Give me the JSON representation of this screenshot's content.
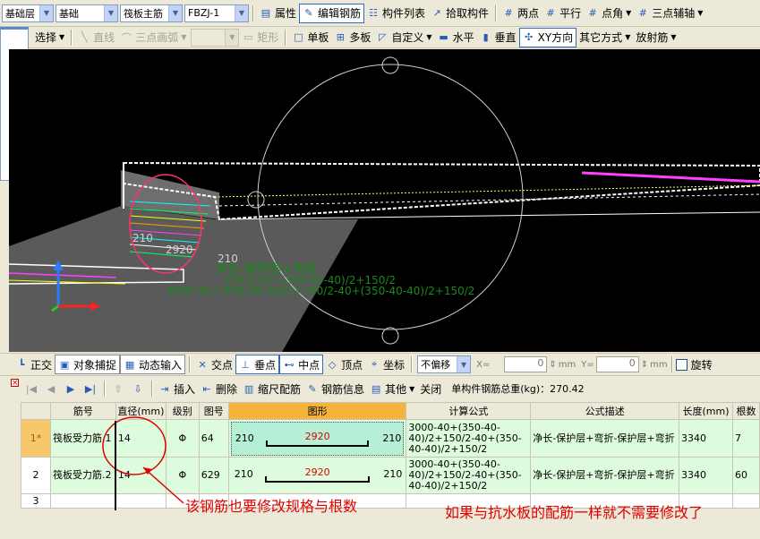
{
  "toolbar1": {
    "layer_select": "基础层",
    "category_select": "基础",
    "member_type_select": "筏板主筋",
    "member_name_select": "FBZJ-1",
    "buttons": [
      "属性",
      "编辑钢筋",
      "构件列表",
      "拾取构件",
      "两点",
      "平行",
      "点角",
      "三点辅轴"
    ]
  },
  "toolbar2": {
    "items": [
      "选择",
      "直线",
      "三点画弧",
      "矩形",
      "单板",
      "多板",
      "自定义",
      "水平",
      "垂直",
      "XY方向",
      "其它方式",
      "放射筋"
    ]
  },
  "viewport": {
    "labels": {
      "dim_210": "210",
      "dim_2920": "2920",
      "dim_210_b": "210",
      "green_text_1": "净长-保护层+弯折",
      "green_text_2": "150/2-40+(350-40-40)/2+150/2",
      "green_text_3": "3000-40+(350-40-40)/2+150/2-40+(350-40-40)/2+150/2"
    }
  },
  "toolbar3": {
    "items": [
      "正交",
      "对象捕捉",
      "动态输入",
      "交点",
      "垂点",
      "中点",
      "顶点",
      "坐标"
    ],
    "offset_select": "不偏移",
    "x_label": "X=",
    "x_value": "0",
    "y_label": "Y=",
    "y_value": "0",
    "unit": "mm",
    "rotate_label": "旋转"
  },
  "rebar_panel": {
    "toolbar": [
      "插入",
      "删除",
      "缩尺配筋",
      "钢筋信息",
      "其他",
      "关闭"
    ],
    "total_weight": "单构件钢筋总重(kg)：270.42",
    "columns": [
      "筋号",
      "直径(mm)",
      "级别",
      "图号",
      "图形",
      "计算公式",
      "公式描述",
      "长度(mm)",
      "根数"
    ],
    "rows": [
      {
        "idx": "1*",
        "name": "筏板受力筋.1",
        "diameter": "14",
        "grade": "Φ",
        "shape_no": "64",
        "left": "210",
        "middle": "2920",
        "right": "210",
        "formula": "3000-40+(350-40-40)/2+150/2-40+(350-40-40)/2+150/2",
        "desc": "净长-保护层+弯折-保护层+弯折",
        "length": "3340",
        "count": "7"
      },
      {
        "idx": "2",
        "name": "筏板受力筋.2",
        "diameter": "14",
        "grade": "Φ",
        "shape_no": "629",
        "left": "210",
        "middle": "2920",
        "right": "210",
        "formula": "3000-40+(350-40-40)/2+150/2-40+(350-40-40)/2+150/2",
        "desc": "净长-保护层+弯折-保护层+弯折",
        "length": "3340",
        "count": "60"
      },
      {
        "idx": "3",
        "name": "",
        "diameter": "",
        "grade": "",
        "shape_no": "",
        "left": "",
        "middle": "",
        "right": "",
        "formula": "",
        "desc": "",
        "length": "",
        "count": ""
      }
    ]
  },
  "annotations": {
    "note_left": "该钢筋也要修改规格与根数",
    "note_right": "如果与抗水板的配筋一样就不需要修改了"
  },
  "colors": {
    "annotation_red": "#e00000",
    "selected_row": "#ddfbdd",
    "shape_header": "#f5b33b",
    "viewport_bg": "#000000"
  }
}
